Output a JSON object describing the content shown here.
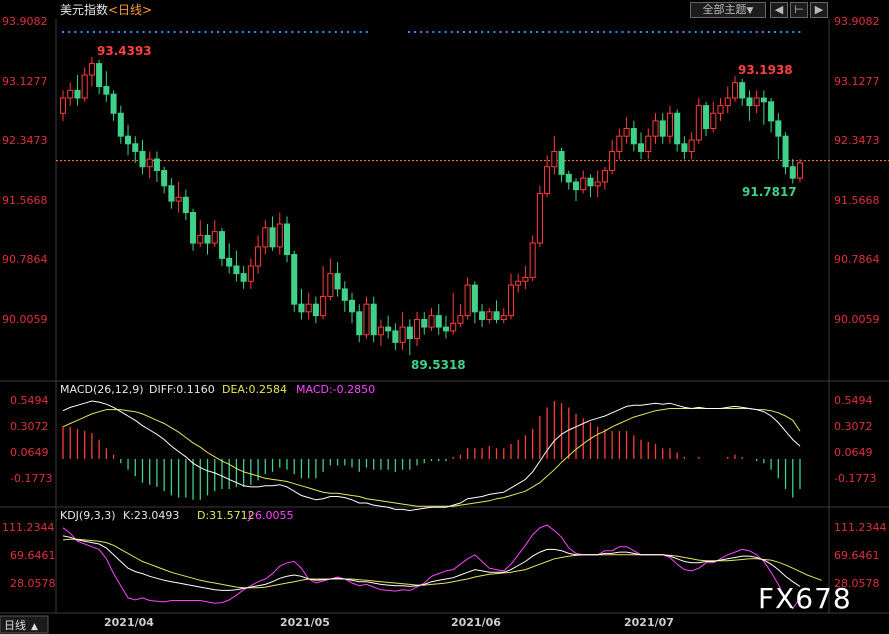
{
  "header": {
    "title": "美元指数",
    "period": "<日线>",
    "menu_label": "全部主题",
    "menu_arrow": "▼",
    "nav_icons": [
      "◀",
      "⊢",
      "▶"
    ]
  },
  "price_panel": {
    "y_ticks": [
      "93.9082",
      "93.1277",
      "92.3473",
      "91.5668",
      "90.7864",
      "90.0059"
    ],
    "current_price": 92.08,
    "annotations": {
      "left_high": "93.4393",
      "left_low": "89.5318",
      "right_high": "93.1938",
      "right_low": "91.7817"
    }
  },
  "macd_panel": {
    "label": "MACD(26,12,9)",
    "diff": "DIFF:0.1160",
    "dea": "DEA:0.2584",
    "macd": "MACD:-0.2850",
    "y_ticks": [
      "0.5494",
      "0.3072",
      "0.0649",
      "-0.1773"
    ]
  },
  "kdj_panel": {
    "label": "KDJ(9,3,3)",
    "k": "K:23.0493",
    "d": "D:31.5712",
    "j": "J:6.0055",
    "y_ticks": [
      "111.2344",
      "69.6461",
      "28.0578"
    ]
  },
  "x_axis": {
    "labels": [
      "2021/04",
      "2021/05",
      "2021/06",
      "2021/07"
    ],
    "period_button": "日线",
    "period_arrow": "▲"
  },
  "watermark": "FX678",
  "colors": {
    "up": "#ff3b3b",
    "down": "#3fd18a",
    "diff": "#ffffff",
    "dea": "#e6e65a",
    "macd_label": "#ff44ff",
    "axis_text": "#e0303a",
    "price_line": "#ff8a3d"
  },
  "chart_data": {
    "type": "candlestick",
    "candles": [
      [
        92.7,
        92.9,
        93.0,
        92.6
      ],
      [
        92.9,
        93.0,
        93.1,
        92.8
      ],
      [
        93.0,
        92.9,
        93.2,
        92.8
      ],
      [
        92.9,
        93.2,
        93.3,
        92.85
      ],
      [
        93.2,
        93.35,
        93.44,
        93.05
      ],
      [
        93.35,
        93.05,
        93.4,
        92.95
      ],
      [
        93.05,
        92.95,
        93.25,
        92.85
      ],
      [
        92.95,
        92.7,
        93.0,
        92.6
      ],
      [
        92.7,
        92.4,
        92.8,
        92.3
      ],
      [
        92.4,
        92.3,
        92.55,
        92.15
      ],
      [
        92.3,
        92.2,
        92.4,
        92.05
      ],
      [
        92.2,
        92.0,
        92.35,
        91.9
      ],
      [
        92.0,
        92.1,
        92.2,
        91.85
      ],
      [
        92.1,
        91.95,
        92.2,
        91.8
      ],
      [
        91.95,
        91.75,
        92.0,
        91.65
      ],
      [
        91.75,
        91.55,
        91.85,
        91.45
      ],
      [
        91.55,
        91.6,
        91.8,
        91.4
      ],
      [
        91.6,
        91.4,
        91.7,
        91.3
      ],
      [
        91.4,
        91.0,
        91.45,
        90.9
      ],
      [
        91.0,
        91.1,
        91.3,
        90.95
      ],
      [
        91.1,
        91.0,
        91.25,
        90.85
      ],
      [
        91.0,
        91.15,
        91.3,
        90.95
      ],
      [
        91.15,
        90.8,
        91.2,
        90.7
      ],
      [
        90.8,
        90.7,
        91.0,
        90.6
      ],
      [
        90.7,
        90.6,
        90.9,
        90.5
      ],
      [
        90.6,
        90.5,
        90.7,
        90.4
      ],
      [
        90.5,
        90.7,
        90.8,
        90.4
      ],
      [
        90.7,
        90.95,
        91.1,
        90.6
      ],
      [
        90.95,
        91.2,
        91.3,
        90.85
      ],
      [
        91.2,
        90.95,
        91.35,
        90.9
      ],
      [
        90.95,
        91.25,
        91.4,
        90.85
      ],
      [
        91.25,
        90.85,
        91.35,
        90.75
      ],
      [
        90.85,
        90.2,
        90.9,
        90.1
      ],
      [
        90.2,
        90.1,
        90.4,
        90.0
      ],
      [
        90.1,
        90.2,
        90.35,
        90.0
      ],
      [
        90.2,
        90.05,
        90.3,
        89.95
      ],
      [
        90.05,
        90.3,
        90.7,
        90.0
      ],
      [
        90.3,
        90.6,
        90.8,
        90.25
      ],
      [
        90.6,
        90.4,
        90.75,
        90.3
      ],
      [
        90.4,
        90.25,
        90.5,
        90.1
      ],
      [
        90.25,
        90.1,
        90.35,
        89.95
      ],
      [
        90.1,
        89.8,
        90.2,
        89.7
      ],
      [
        89.8,
        90.2,
        90.3,
        89.75
      ],
      [
        90.2,
        89.8,
        90.3,
        89.7
      ],
      [
        89.8,
        89.9,
        90.0,
        89.65
      ],
      [
        89.9,
        89.85,
        90.05,
        89.75
      ],
      [
        89.85,
        89.7,
        89.95,
        89.6
      ],
      [
        89.7,
        89.9,
        90.1,
        89.6
      ],
      [
        89.9,
        89.75,
        90.0,
        89.53
      ],
      [
        89.75,
        90.0,
        90.1,
        89.65
      ],
      [
        90.0,
        89.9,
        90.1,
        89.8
      ],
      [
        89.9,
        90.05,
        90.15,
        89.85
      ],
      [
        90.05,
        89.9,
        90.2,
        89.8
      ],
      [
        89.9,
        89.85,
        90.05,
        89.75
      ],
      [
        89.85,
        89.95,
        90.35,
        89.8
      ],
      [
        89.95,
        90.05,
        90.2,
        89.9
      ],
      [
        90.05,
        90.45,
        90.55,
        90.0
      ],
      [
        90.45,
        90.1,
        90.5,
        89.95
      ],
      [
        90.1,
        90.0,
        90.2,
        89.9
      ],
      [
        90.0,
        90.1,
        90.15,
        89.95
      ],
      [
        90.1,
        90.0,
        90.25,
        89.95
      ],
      [
        90.0,
        90.05,
        90.15,
        89.95
      ],
      [
        90.05,
        90.45,
        90.6,
        90.0
      ],
      [
        90.45,
        90.5,
        90.6,
        90.35
      ],
      [
        90.5,
        90.55,
        90.7,
        90.4
      ],
      [
        90.55,
        91.0,
        91.1,
        90.5
      ],
      [
        91.0,
        91.65,
        91.75,
        90.95
      ],
      [
        91.65,
        92.0,
        92.15,
        91.6
      ],
      [
        92.0,
        92.2,
        92.4,
        91.9
      ],
      [
        92.2,
        91.9,
        92.25,
        91.8
      ],
      [
        91.9,
        91.8,
        91.95,
        91.7
      ],
      [
        91.8,
        91.7,
        91.85,
        91.55
      ],
      [
        91.7,
        91.85,
        91.95,
        91.65
      ],
      [
        91.85,
        91.75,
        91.9,
        91.6
      ],
      [
        91.75,
        91.8,
        91.95,
        91.6
      ],
      [
        91.8,
        91.95,
        92.0,
        91.7
      ],
      [
        91.95,
        92.2,
        92.35,
        91.9
      ],
      [
        92.2,
        92.4,
        92.5,
        92.1
      ],
      [
        92.4,
        92.5,
        92.65,
        92.3
      ],
      [
        92.5,
        92.3,
        92.6,
        92.2
      ],
      [
        92.3,
        92.2,
        92.45,
        92.1
      ],
      [
        92.2,
        92.4,
        92.5,
        92.1
      ],
      [
        92.4,
        92.6,
        92.7,
        92.3
      ],
      [
        92.6,
        92.4,
        92.7,
        92.3
      ],
      [
        92.4,
        92.7,
        92.8,
        92.3
      ],
      [
        92.7,
        92.3,
        92.75,
        92.2
      ],
      [
        92.3,
        92.2,
        92.4,
        92.1
      ],
      [
        92.2,
        92.35,
        92.45,
        92.1
      ],
      [
        92.35,
        92.8,
        92.9,
        92.3
      ],
      [
        92.8,
        92.5,
        92.85,
        92.4
      ],
      [
        92.5,
        92.7,
        92.85,
        92.45
      ],
      [
        92.7,
        92.8,
        92.9,
        92.6
      ],
      [
        92.8,
        92.9,
        93.05,
        92.7
      ],
      [
        92.9,
        93.1,
        93.19,
        92.85
      ],
      [
        93.1,
        92.9,
        93.15,
        92.8
      ],
      [
        92.9,
        92.8,
        93.0,
        92.6
      ],
      [
        92.8,
        92.9,
        93.0,
        92.7
      ],
      [
        92.9,
        92.85,
        93.0,
        92.55
      ],
      [
        92.85,
        92.6,
        92.9,
        92.45
      ],
      [
        92.6,
        92.4,
        92.7,
        92.1
      ],
      [
        92.4,
        92.0,
        92.45,
        91.9
      ],
      [
        92.0,
        91.85,
        92.1,
        91.78
      ],
      [
        91.85,
        92.05,
        92.1,
        91.8
      ]
    ],
    "macd": {
      "diff": [
        0.45,
        0.48,
        0.5,
        0.52,
        0.54,
        0.53,
        0.51,
        0.48,
        0.44,
        0.4,
        0.36,
        0.31,
        0.27,
        0.23,
        0.18,
        0.12,
        0.07,
        0.02,
        -0.04,
        -0.08,
        -0.11,
        -0.13,
        -0.16,
        -0.19,
        -0.22,
        -0.25,
        -0.26,
        -0.26,
        -0.25,
        -0.25,
        -0.24,
        -0.26,
        -0.3,
        -0.34,
        -0.36,
        -0.38,
        -0.37,
        -0.35,
        -0.35,
        -0.36,
        -0.38,
        -0.41,
        -0.41,
        -0.43,
        -0.44,
        -0.45,
        -0.47,
        -0.47,
        -0.48,
        -0.47,
        -0.46,
        -0.45,
        -0.45,
        -0.45,
        -0.43,
        -0.41,
        -0.37,
        -0.36,
        -0.35,
        -0.33,
        -0.32,
        -0.31,
        -0.27,
        -0.23,
        -0.19,
        -0.12,
        -0.02,
        0.08,
        0.17,
        0.23,
        0.27,
        0.3,
        0.33,
        0.36,
        0.38,
        0.4,
        0.43,
        0.46,
        0.49,
        0.5,
        0.5,
        0.51,
        0.52,
        0.51,
        0.52,
        0.5,
        0.48,
        0.47,
        0.48,
        0.47,
        0.47,
        0.47,
        0.48,
        0.49,
        0.48,
        0.47,
        0.46,
        0.44,
        0.4,
        0.34,
        0.26,
        0.18,
        0.12
      ],
      "dea": [
        0.3,
        0.33,
        0.36,
        0.39,
        0.42,
        0.44,
        0.46,
        0.46,
        0.46,
        0.45,
        0.44,
        0.42,
        0.39,
        0.36,
        0.33,
        0.29,
        0.25,
        0.2,
        0.15,
        0.11,
        0.06,
        0.02,
        -0.02,
        -0.05,
        -0.09,
        -0.12,
        -0.14,
        -0.16,
        -0.18,
        -0.19,
        -0.2,
        -0.21,
        -0.23,
        -0.25,
        -0.27,
        -0.29,
        -0.31,
        -0.32,
        -0.32,
        -0.33,
        -0.34,
        -0.35,
        -0.37,
        -0.38,
        -0.39,
        -0.4,
        -0.41,
        -0.42,
        -0.43,
        -0.44,
        -0.44,
        -0.44,
        -0.44,
        -0.44,
        -0.44,
        -0.43,
        -0.42,
        -0.41,
        -0.4,
        -0.39,
        -0.37,
        -0.36,
        -0.34,
        -0.32,
        -0.3,
        -0.26,
        -0.22,
        -0.16,
        -0.1,
        -0.03,
        0.03,
        0.09,
        0.14,
        0.19,
        0.23,
        0.26,
        0.3,
        0.33,
        0.36,
        0.39,
        0.41,
        0.43,
        0.45,
        0.46,
        0.47,
        0.47,
        0.47,
        0.47,
        0.47,
        0.47,
        0.47,
        0.47,
        0.47,
        0.47,
        0.47,
        0.47,
        0.46,
        0.46,
        0.45,
        0.43,
        0.4,
        0.36,
        0.26
      ],
      "hist": [
        0.3,
        0.3,
        0.28,
        0.26,
        0.24,
        0.18,
        0.1,
        0.04,
        -0.04,
        -0.1,
        -0.16,
        -0.22,
        -0.24,
        -0.26,
        -0.3,
        -0.34,
        -0.36,
        -0.36,
        -0.38,
        -0.38,
        -0.34,
        -0.3,
        -0.28,
        -0.28,
        -0.26,
        -0.26,
        -0.24,
        -0.2,
        -0.14,
        -0.12,
        -0.08,
        -0.1,
        -0.14,
        -0.18,
        -0.18,
        -0.18,
        -0.12,
        -0.06,
        -0.06,
        -0.06,
        -0.08,
        -0.12,
        -0.08,
        -0.1,
        -0.1,
        -0.1,
        -0.12,
        -0.1,
        -0.1,
        -0.06,
        -0.04,
        -0.02,
        -0.02,
        -0.02,
        0.02,
        0.04,
        0.1,
        0.1,
        0.1,
        0.12,
        0.1,
        0.1,
        0.14,
        0.18,
        0.22,
        0.28,
        0.4,
        0.48,
        0.54,
        0.52,
        0.48,
        0.42,
        0.38,
        0.34,
        0.3,
        0.28,
        0.26,
        0.26,
        0.26,
        0.22,
        0.18,
        0.16,
        0.14,
        0.1,
        0.1,
        0.06,
        0.02,
        0.0,
        0.02,
        0.0,
        0.0,
        0.0,
        0.02,
        0.04,
        0.02,
        0.0,
        -0.02,
        -0.04,
        -0.1,
        -0.18,
        -0.28,
        -0.36,
        -0.28
      ]
    },
    "kdj": {
      "k": [
        98,
        96,
        92,
        90,
        88,
        86,
        80,
        70,
        60,
        50,
        45,
        42,
        38,
        35,
        32,
        30,
        28,
        26,
        24,
        22,
        20,
        18,
        17,
        17,
        18,
        20,
        22,
        24,
        26,
        30,
        35,
        38,
        40,
        38,
        34,
        32,
        33,
        34,
        35,
        34,
        32,
        30,
        30,
        28,
        26,
        25,
        24,
        24,
        23,
        24,
        26,
        30,
        32,
        34,
        36,
        40,
        44,
        48,
        46,
        44,
        44,
        44,
        48,
        54,
        60,
        68,
        74,
        78,
        78,
        76,
        72,
        70,
        70,
        70,
        70,
        72,
        72,
        74,
        74,
        72,
        70,
        70,
        70,
        70,
        68,
        64,
        60,
        58,
        58,
        60,
        60,
        62,
        64,
        66,
        68,
        68,
        66,
        62,
        56,
        48,
        38,
        30,
        23
      ],
      "d": [
        92,
        93,
        93,
        92,
        91,
        90,
        88,
        84,
        78,
        72,
        66,
        60,
        56,
        52,
        48,
        44,
        41,
        38,
        35,
        32,
        30,
        28,
        26,
        24,
        22,
        21,
        21,
        21,
        22,
        24,
        26,
        28,
        30,
        32,
        34,
        34,
        34,
        34,
        34,
        34,
        34,
        33,
        32,
        31,
        30,
        29,
        28,
        27,
        26,
        25,
        25,
        26,
        27,
        28,
        30,
        32,
        34,
        37,
        39,
        41,
        42,
        43,
        44,
        46,
        48,
        52,
        56,
        60,
        64,
        66,
        68,
        69,
        70,
        70,
        70,
        70,
        70,
        70,
        70,
        70,
        70,
        70,
        70,
        70,
        69,
        68,
        66,
        64,
        62,
        61,
        61,
        61,
        61,
        62,
        63,
        64,
        64,
        63,
        62,
        59,
        55,
        50,
        45,
        40,
        36,
        32
      ],
      "j": [
        110,
        102,
        90,
        86,
        82,
        78,
        64,
        42,
        24,
        6,
        3,
        6,
        2,
        1,
        0,
        2,
        2,
        2,
        2,
        2,
        0,
        -2,
        -1,
        3,
        10,
        18,
        24,
        30,
        34,
        42,
        53,
        58,
        60,
        50,
        34,
        28,
        31,
        34,
        37,
        34,
        28,
        24,
        26,
        22,
        18,
        17,
        16,
        18,
        17,
        22,
        28,
        38,
        42,
        46,
        48,
        56,
        64,
        70,
        60,
        50,
        48,
        46,
        56,
        70,
        84,
        100,
        110,
        114,
        106,
        96,
        80,
        72,
        70,
        70,
        70,
        76,
        76,
        82,
        82,
        76,
        70,
        70,
        70,
        70,
        66,
        56,
        48,
        46,
        50,
        58,
        58,
        64,
        70,
        74,
        78,
        76,
        70,
        60,
        44,
        26,
        4,
        -10,
        6
      ]
    }
  }
}
